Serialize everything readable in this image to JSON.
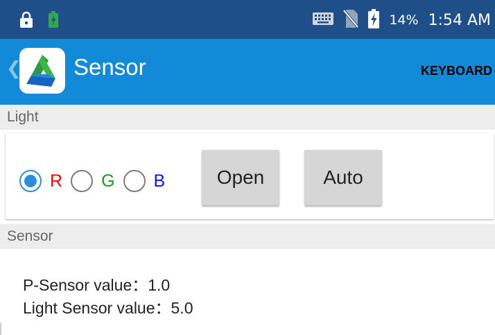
{
  "status_bar": {
    "battery_percent": "14%",
    "time": "1:54 AM",
    "icons": [
      "lock-icon",
      "battery-saver-icon",
      "keyboard-icon",
      "no-sim-icon",
      "battery-charging-icon"
    ]
  },
  "app_bar": {
    "title": "Sensor",
    "action_label": "KEYBOARD"
  },
  "light_section": {
    "header": "Light",
    "radios": [
      {
        "label": "R",
        "color": "#ff0000",
        "checked": true
      },
      {
        "label": "G",
        "color": "#1a9a1a",
        "checked": false
      },
      {
        "label": "B",
        "color": "#1010ff",
        "checked": false
      }
    ],
    "open_button": "Open",
    "auto_button": "Auto"
  },
  "sensor_section": {
    "header": "Sensor",
    "p_sensor_line": "P-Sensor value：1.0",
    "light_sensor_line": "Light Sensor value：5.0"
  },
  "colors": {
    "status_bar": "#1f4f88",
    "app_bar": "#138ad8",
    "accent": "#2a8ee0"
  }
}
